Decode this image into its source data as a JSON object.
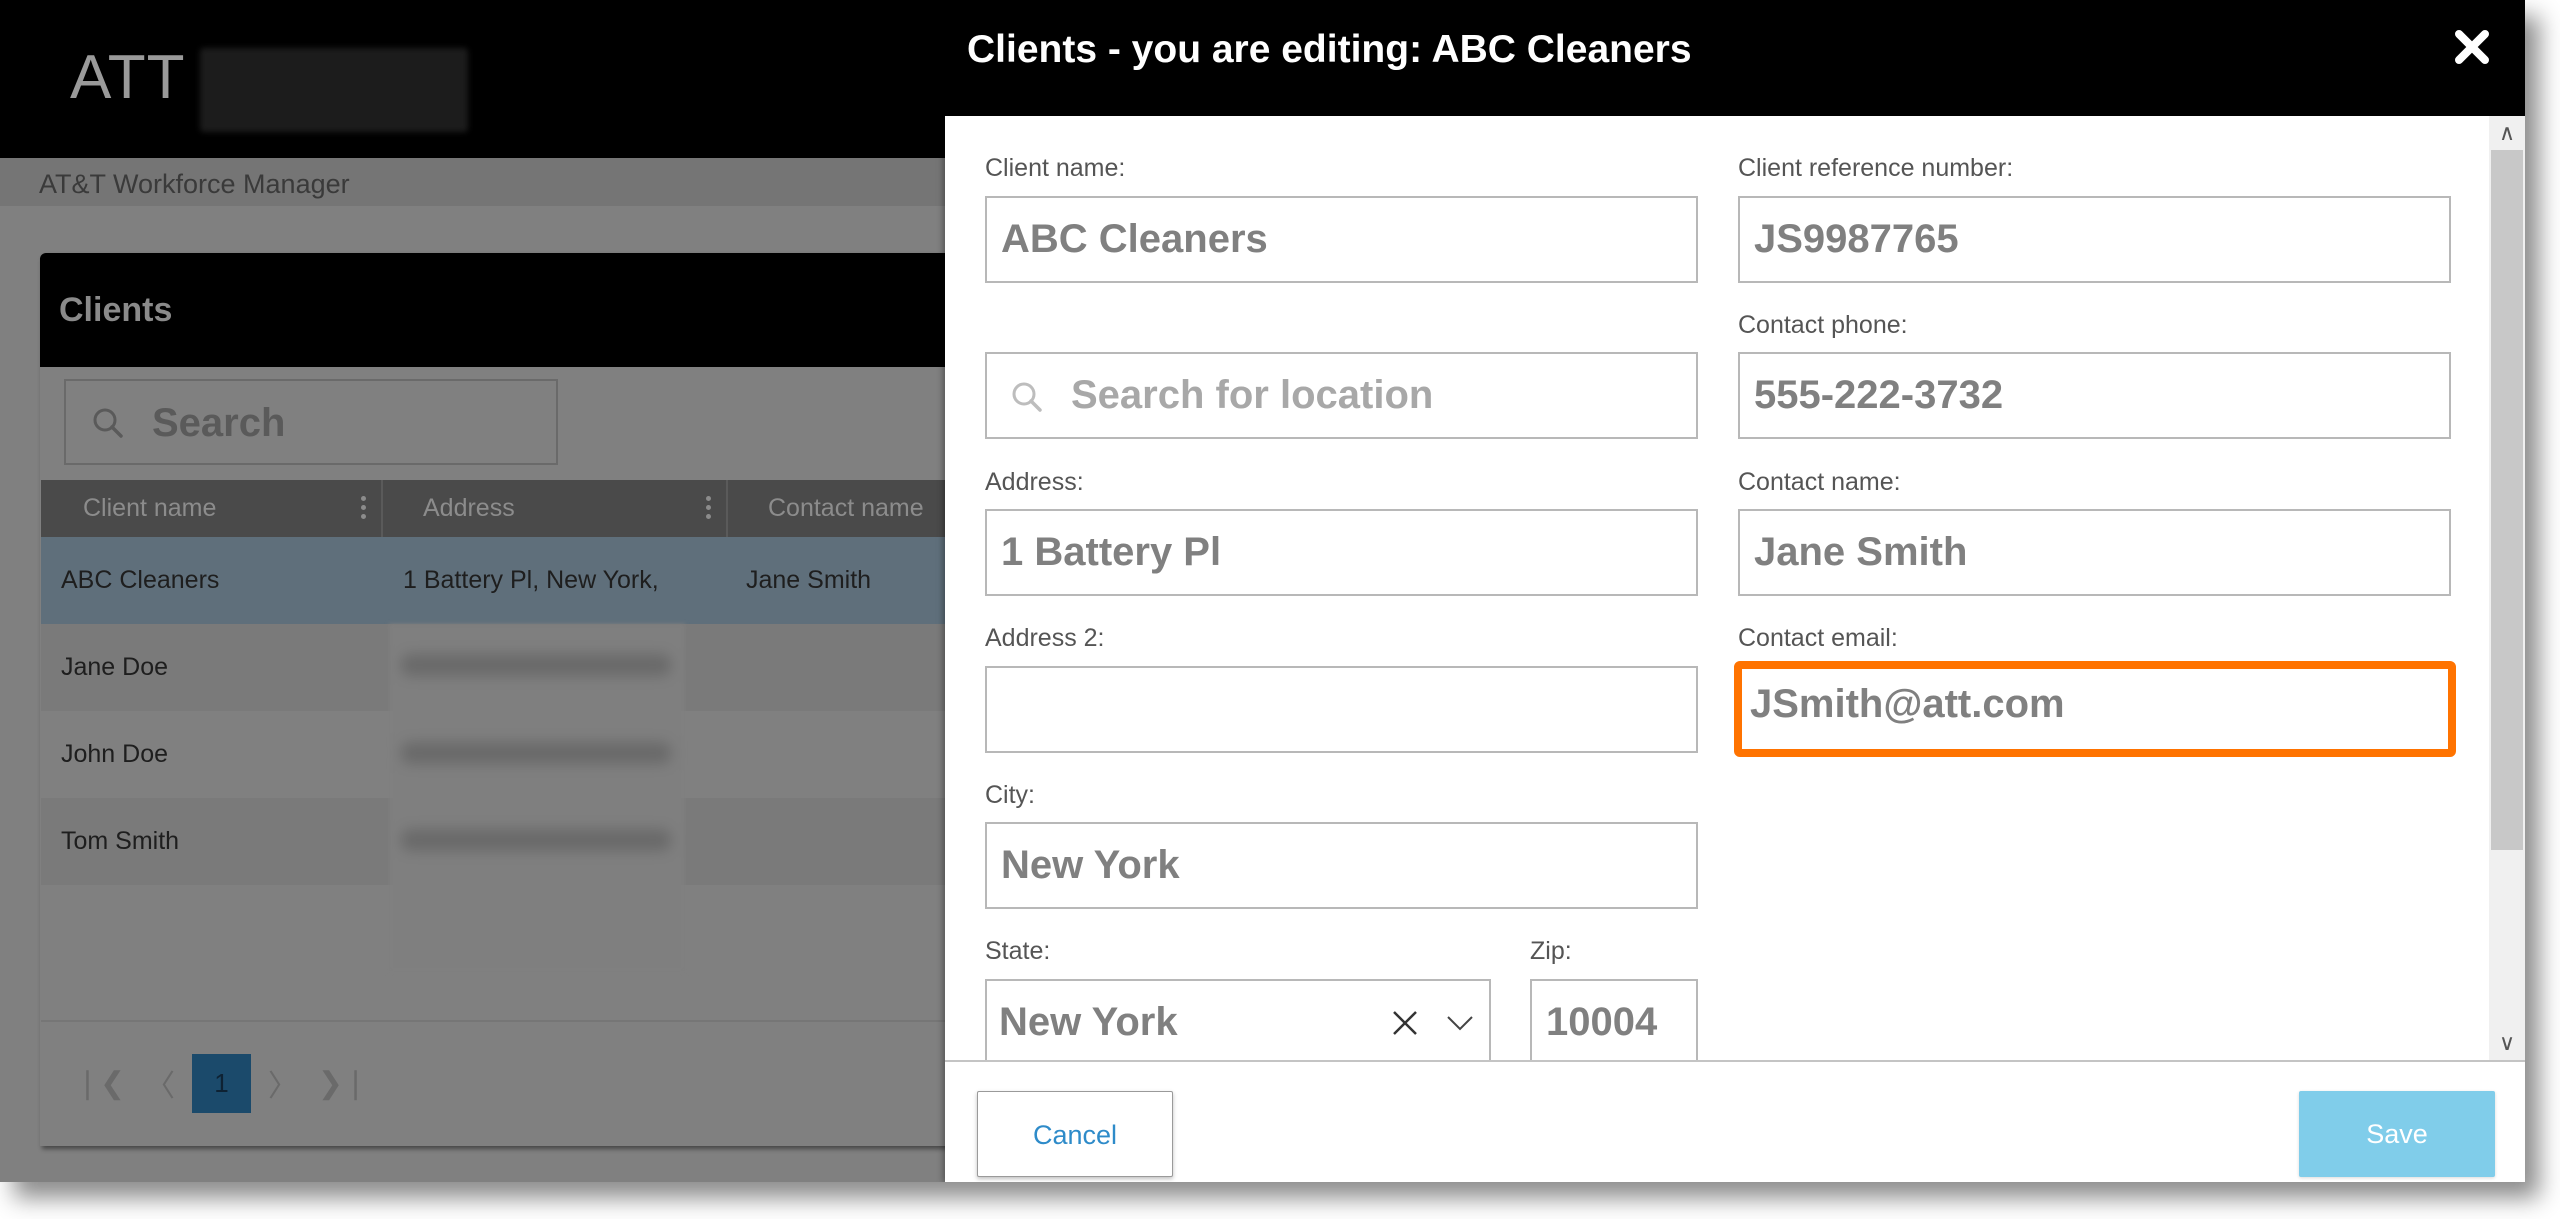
{
  "app": {
    "logo_text": "ATT",
    "subtitle": "AT&T Workforce Manager"
  },
  "clients_panel": {
    "title": "Clients",
    "search_placeholder": "Search",
    "columns": [
      "Client name",
      "Address",
      "Contact name"
    ],
    "rows": [
      {
        "client_name": "ABC Cleaners",
        "address": "1 Battery Pl, New York,",
        "contact_name": "Jane Smith",
        "selected": true
      },
      {
        "client_name": "Jane Doe",
        "address": "",
        "contact_name": ""
      },
      {
        "client_name": "John Doe",
        "address": "",
        "contact_name": ""
      },
      {
        "client_name": "Tom Smith",
        "address": "",
        "contact_name": ""
      }
    ],
    "pagination": {
      "first_icon": "first-page-icon",
      "prev_icon": "prev-page-icon",
      "current_page": "1",
      "next_icon": "next-page-icon",
      "last_icon": "last-page-icon"
    }
  },
  "modal": {
    "title": "Clients - you are editing: ABC Cleaners",
    "close_icon": "close-icon",
    "fields": {
      "client_name": {
        "label": "Client name:",
        "value": "ABC Cleaners"
      },
      "location_search": {
        "placeholder": "Search for location"
      },
      "address": {
        "label": "Address:",
        "value": "1 Battery Pl"
      },
      "address2": {
        "label": "Address 2:",
        "value": ""
      },
      "city": {
        "label": "City:",
        "value": "New York"
      },
      "state": {
        "label": "State:",
        "value": "New York"
      },
      "zip": {
        "label": "Zip:",
        "value": "10004"
      },
      "reference_number": {
        "label": "Client reference number:",
        "value": "JS9987765"
      },
      "contact_phone": {
        "label": "Contact phone:",
        "value": "555-222-3732"
      },
      "contact_name": {
        "label": "Contact name:",
        "value": "Jane Smith"
      },
      "contact_email": {
        "label": "Contact email:",
        "value": "JSmith@att.com"
      }
    },
    "buttons": {
      "cancel": "Cancel",
      "save": "Save"
    }
  },
  "colors": {
    "highlight": "#ff7300",
    "save_button": "#80cdea",
    "cancel_text": "#2e8bc9",
    "selected_row": "#5f6f7b",
    "current_page": "#1b4a6b"
  }
}
